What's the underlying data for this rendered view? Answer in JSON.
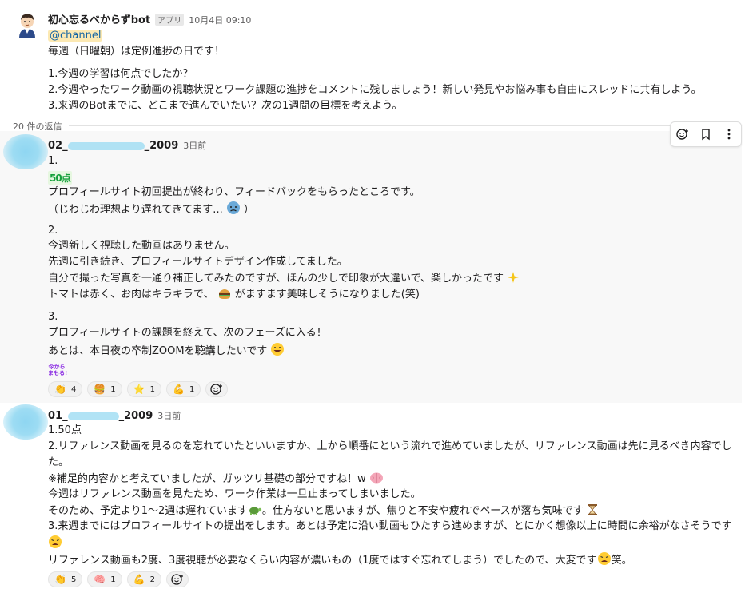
{
  "parent": {
    "bot_name": "初心忘るべからずbot",
    "app_badge": "アプリ",
    "timestamp": "10月4日 09:10",
    "mention": "@channel",
    "lines": [
      "毎週（日曜朝）は定例進捗の日です！",
      "1.今週の学習は何点でしたか？",
      "2.今週やったワーク動画の視聴状況とワーク課題の進捗をコメントに残しましょう！新しい発見やお悩み事も自由にスレッドに共有しよう。",
      "3.来週のBotまでに、どこまで進んでいたい？次の1週間の目標を考えよう。"
    ]
  },
  "thread": {
    "reply_count": "20 件の返信"
  },
  "toolbar": {
    "icons": [
      "emoji-reaction-icon",
      "bookmark-icon",
      "more-icon"
    ]
  },
  "reply1": {
    "name_prefix": "02_",
    "name_suffix": "_2009",
    "time": "3日前",
    "stamp": "50点",
    "lines": [
      "1.",
      "プロフィールサイト初回提出が終わり、フィードバックをもらったところです。",
      "（じわじわ理想より遅れてきてます...",
      "）",
      "2.",
      "今週新しく視聴した動画はありません。",
      "先週に引き続き、プロフィールサイトデザイン作成してました。",
      "自分で撮った写真を一通り補正してみたのですが、ほんの少しで印象が大違いで、楽しかったです",
      "トマトは赤く、お肉はキラキラで、",
      "がますます美味しそうになりました(笑)",
      "3.",
      "プロフィールサイトの課題を終えて、次のフェーズに入る！",
      "あとは、本日夜の卒制ZOOMを聴講したいです"
    ],
    "stamp2": "今から\nまもる!",
    "reactions": [
      {
        "icon": "clap-icon",
        "glyph": "👏",
        "count": "4"
      },
      {
        "icon": "burger-icon",
        "glyph": "🍔",
        "count": "1"
      },
      {
        "icon": "star-icon",
        "glyph": "⭐",
        "count": "1"
      },
      {
        "icon": "muscle-icon",
        "glyph": "💪",
        "count": "1"
      }
    ]
  },
  "reply2": {
    "name_prefix": "01_",
    "name_suffix": "_2009",
    "time": "3日前",
    "lines": [
      "1.50点",
      "2.リファレンス動画を見るのを忘れていたといいますか、上から順番にという流れで進めていましたが、リファレンス動画は先に見るべき内容でし",
      "た。",
      "※補足的内容かと考えていましたが、ガッツリ基礎の部分ですね！w",
      "今週はリファレンス動画を見たため、ワーク作業は一旦止まってしまいました。",
      "そのため、予定より1〜2週は遅れています",
      "。仕方ないと思いますが、焦りと不安や疲れでペースが落ち気味です",
      "3.来週までにはプロフィールサイトの提出をします。あとは予定に沿い動画もひたすら進めますが、とにかく想像以上に時間に余裕がなさそうです",
      "リファレンス動画も2度、3度視聴が必要なくらい内容が濃いもの（1度ではすぐ忘れてしまう）でしたので、大変です",
      "笑。"
    ],
    "reactions": [
      {
        "icon": "clap-icon",
        "glyph": "👏",
        "count": "5"
      },
      {
        "icon": "brain-icon",
        "glyph": "🧠",
        "count": "1"
      },
      {
        "icon": "muscle-icon",
        "glyph": "💪",
        "count": "2"
      }
    ]
  }
}
